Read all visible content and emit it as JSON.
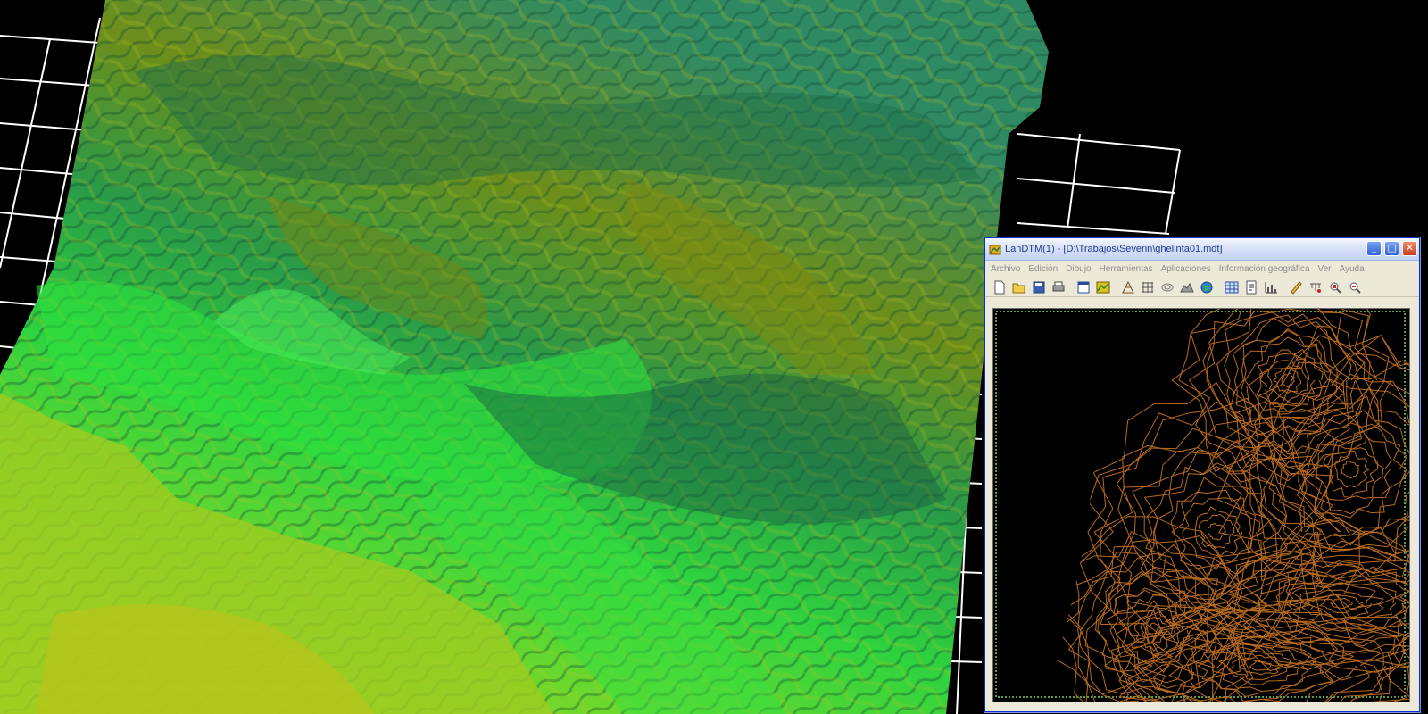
{
  "window": {
    "title": "LanDTM(1) - [D:\\Trabajos\\Severin\\ghelinta01.mdt]",
    "controls": {
      "minimize": "_",
      "maximize": "□",
      "close": "✕"
    }
  },
  "menu": [
    "Archivo",
    "Edición",
    "Dibujo",
    "Herramientas",
    "Aplicaciones",
    "Información geográfica",
    "Ver",
    "Ayuda"
  ],
  "toolbar": {
    "icons": [
      "new-file-icon",
      "open-folder-icon",
      "save-icon",
      "print-icon",
      "window-icon",
      "map-icon",
      "triangulate-icon",
      "grid-icon",
      "contour-icon",
      "profile-icon",
      "globe-icon",
      "table-icon",
      "settings-icon",
      "chart-icon",
      "pencil-icon",
      "measure-icon",
      "zoom-area-icon",
      "zoom-out-icon"
    ]
  },
  "colors": {
    "background": "#000000",
    "grid": "#ffffff",
    "axis_labels": "#2a3cff",
    "contour": "#b86b1e",
    "viewport_border": "#5a9d4a",
    "terrain_low": "#9fcf1f",
    "terrain_mid": "#2ed63d",
    "terrain_high": "#1d6b4a",
    "terrain_peak": "#7f8f14"
  }
}
